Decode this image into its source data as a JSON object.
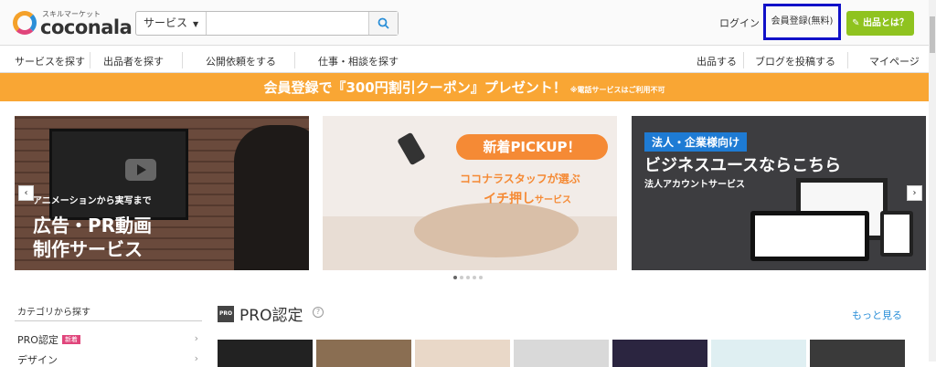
{
  "header": {
    "logo_sub": "スキルマーケット",
    "logo_text": "coconala",
    "search_category": "サービス",
    "search_placeholder": "",
    "login": "ログイン",
    "register": "会員登録(無料)",
    "post": "出品とは？"
  },
  "nav": {
    "items": [
      "サービスを探す",
      "出品者を探す",
      "公開依頼をする",
      "仕事・相談を探す",
      "出品する",
      "ブログを投稿する",
      "マイページ"
    ]
  },
  "banner": {
    "main": "会員登録で『300円割引クーポン』プレゼント！",
    "note": "※電話サービスはご利用不可"
  },
  "slides": {
    "s1_small": "アニメーションから実写まで",
    "s1_big1": "広告・PR動画",
    "s1_big2": "制作サービス",
    "s2_pick": "新着PICKUP！",
    "s2_line1": "ココナラスタッフが選ぶ",
    "s2_line2a": "イチ押し",
    "s2_line2b": "サービス",
    "s3_tag": "法人・企業様向け",
    "s3_title": "ビジネスユースならこちら",
    "s3_sub": "法人アカウントサービス",
    "prev": "‹",
    "next": "›"
  },
  "sidebar": {
    "heading": "カテゴリから探す",
    "items": [
      {
        "label": "PRO認定",
        "badge": "新着"
      },
      {
        "label": "デザイン"
      }
    ]
  },
  "pro": {
    "icon": "PRO",
    "title": "PRO認定",
    "more": "もっと見る"
  },
  "colors": {
    "accent_orange": "#f9a634",
    "post_green": "#8fc31f",
    "link_blue": "#2b8fd8",
    "highlight_box": "#1010c8"
  }
}
